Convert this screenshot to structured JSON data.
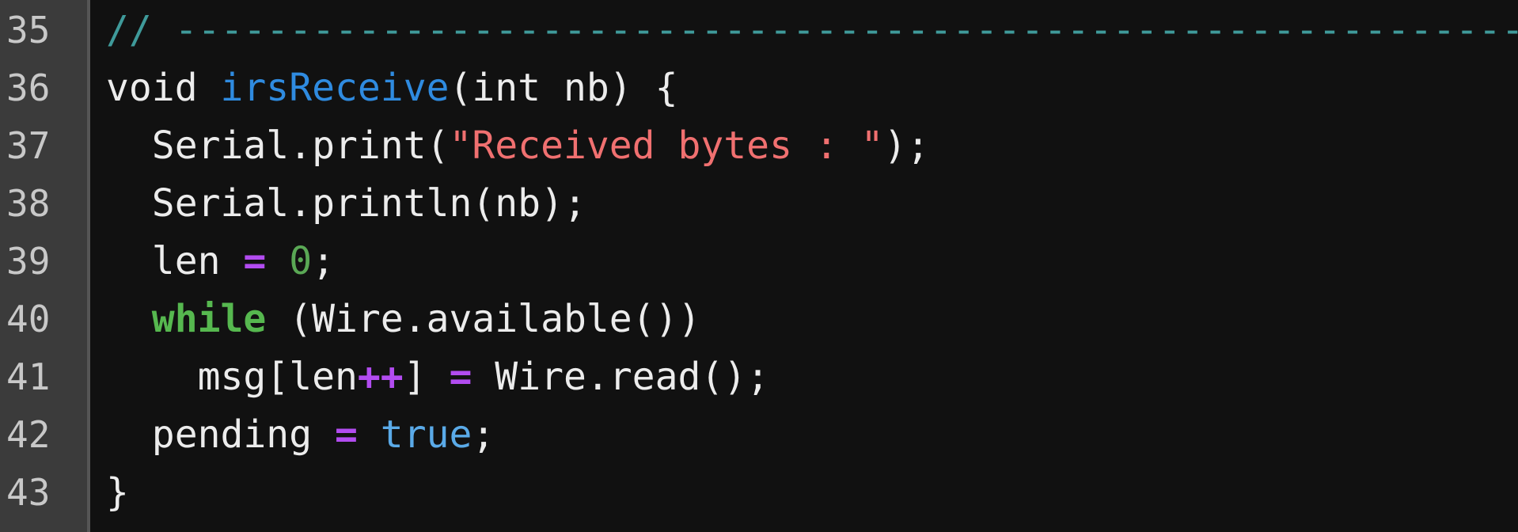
{
  "colors": {
    "background": "#111111",
    "gutter": "#3b3b3b",
    "comment": "#3f9a9a",
    "function": "#2f8be0",
    "string": "#f07070",
    "operator": "#b24cf0",
    "number": "#5aa855",
    "keyword": "#56b84f",
    "boolean": "#5aaae8",
    "text": "#ececec"
  },
  "lines": [
    {
      "number": "35",
      "tokens": [
        {
          "t": "// -----------------------------------------------------------",
          "c": "comment"
        }
      ]
    },
    {
      "number": "36",
      "tokens": [
        {
          "t": "void ",
          "c": "plain"
        },
        {
          "t": "irsReceive",
          "c": "func"
        },
        {
          "t": "(int nb) {",
          "c": "plain"
        }
      ]
    },
    {
      "number": "37",
      "tokens": [
        {
          "t": "  Serial.print(",
          "c": "plain"
        },
        {
          "t": "\"Received bytes : \"",
          "c": "str"
        },
        {
          "t": ");",
          "c": "plain"
        }
      ]
    },
    {
      "number": "38",
      "tokens": [
        {
          "t": "  Serial.println(nb);",
          "c": "plain"
        }
      ]
    },
    {
      "number": "39",
      "tokens": [
        {
          "t": "  len ",
          "c": "plain"
        },
        {
          "t": "=",
          "c": "op"
        },
        {
          "t": " ",
          "c": "plain"
        },
        {
          "t": "0",
          "c": "num"
        },
        {
          "t": ";",
          "c": "plain"
        }
      ]
    },
    {
      "number": "40",
      "tokens": [
        {
          "t": "  ",
          "c": "plain"
        },
        {
          "t": "while",
          "c": "kw"
        },
        {
          "t": " (Wire.available())",
          "c": "plain"
        }
      ]
    },
    {
      "number": "41",
      "tokens": [
        {
          "t": "    msg[len",
          "c": "plain"
        },
        {
          "t": "++",
          "c": "op"
        },
        {
          "t": "] ",
          "c": "plain"
        },
        {
          "t": "=",
          "c": "op"
        },
        {
          "t": " Wire.read();",
          "c": "plain"
        }
      ]
    },
    {
      "number": "42",
      "tokens": [
        {
          "t": "  pending ",
          "c": "plain"
        },
        {
          "t": "=",
          "c": "op"
        },
        {
          "t": " ",
          "c": "plain"
        },
        {
          "t": "true",
          "c": "bool"
        },
        {
          "t": ";",
          "c": "plain"
        }
      ]
    },
    {
      "number": "43",
      "tokens": [
        {
          "t": "}",
          "c": "plain"
        }
      ]
    }
  ]
}
